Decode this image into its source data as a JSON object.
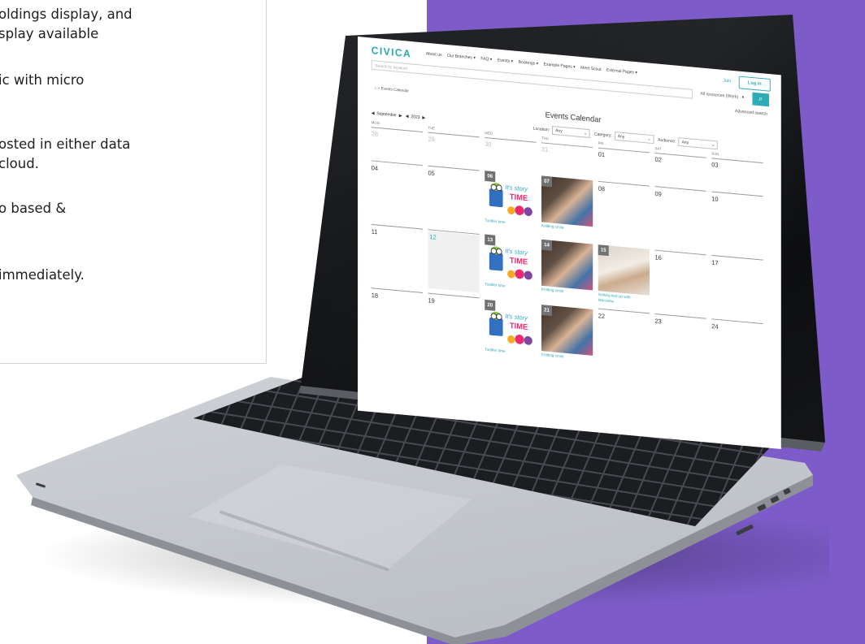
{
  "panel": {
    "lines": [
      "oldings display, and",
      "splay available",
      "ic with micro",
      "osted in either data",
      " cloud.",
      "o based &",
      " immediately."
    ]
  },
  "site": {
    "logo": "CIVICA",
    "nav": [
      "About us",
      "Our Branches ▾",
      "FAQ ▾",
      "Events ▾",
      "Bookings ▾",
      "Example Pages ▾",
      "Meet Scout",
      "External Pages ▾"
    ],
    "join": "Join",
    "login": "Log in",
    "search_placeholder": "Search by keyword",
    "resource_select": "All resources (Work)",
    "advanced_search": "Advanced search",
    "breadcrumb": "⌂  >  Events Calendar",
    "page_title": "Events Calendar",
    "month": "September",
    "year": "2023",
    "filters": {
      "location_label": "Location:",
      "location_value": "Any",
      "category_label": "Category:",
      "category_value": "Any",
      "audience_label": "Audience:",
      "audience_value": "Any"
    },
    "day_names": [
      "MON",
      "TUE",
      "WED",
      "THU",
      "FRI",
      "SAT",
      "SUN"
    ],
    "week1": [
      "28",
      "29",
      "30",
      "31",
      "01",
      "02",
      "03"
    ],
    "week2": [
      "04",
      "05",
      "06",
      "07",
      "08",
      "09",
      "10"
    ],
    "week3": [
      "11",
      "12",
      "13",
      "14",
      "15",
      "16",
      "17"
    ],
    "week4": [
      "18",
      "19",
      "20",
      "21",
      "22",
      "23",
      "24"
    ],
    "events": {
      "e06": "Toddler time",
      "e07": "Knitting circle",
      "e13": "Toddler time",
      "e14": "Knitting circle",
      "e15": "Getting tied up with Macrame",
      "e20": "Toddler time",
      "e21": "Knitting circle"
    },
    "storytime_text": "It's story",
    "storytime_time": "TIME"
  },
  "colors": {
    "brand_teal": "#2aa8b5",
    "purple_background": "#7d5cc9"
  }
}
